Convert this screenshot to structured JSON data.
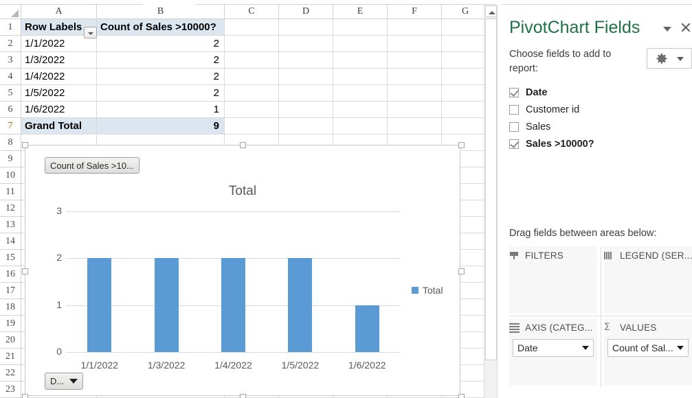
{
  "workbook": {
    "columns": [
      "A",
      "B",
      "C",
      "D",
      "E",
      "F",
      "G"
    ],
    "rows": [
      "1",
      "2",
      "3",
      "4",
      "5",
      "6",
      "7",
      "8",
      "9",
      "10",
      "11",
      "12",
      "13",
      "14",
      "15",
      "16",
      "17",
      "18",
      "19",
      "20",
      "21",
      "22",
      "23"
    ],
    "pivot_table": {
      "headers": [
        "Row Labels",
        "Count of Sales >10000?"
      ],
      "rows": [
        {
          "label": "1/1/2022",
          "value": "2"
        },
        {
          "label": "1/3/2022",
          "value": "2"
        },
        {
          "label": "1/4/2022",
          "value": "2"
        },
        {
          "label": "1/5/2022",
          "value": "2"
        },
        {
          "label": "1/6/2022",
          "value": "1"
        }
      ],
      "total": {
        "label": "Grand Total",
        "value": "9"
      }
    }
  },
  "chart": {
    "title": "Total",
    "series_field_button": "Count of Sales >10...",
    "axis_field_button": "D...",
    "legend": [
      {
        "label": "Total",
        "color": "#5b9bd5"
      }
    ]
  },
  "chart_data": {
    "type": "bar",
    "title": "Total",
    "categories": [
      "1/1/2022",
      "1/3/2022",
      "1/4/2022",
      "1/5/2022",
      "1/6/2022"
    ],
    "values": [
      2,
      2,
      2,
      2,
      1
    ],
    "series": [
      {
        "name": "Total",
        "values": [
          2,
          2,
          2,
          2,
          1
        ],
        "color": "#5b9bd5"
      }
    ],
    "xlabel": "",
    "ylabel": "",
    "ylim": [
      0,
      3
    ],
    "yticks": [
      "0",
      "1",
      "2",
      "3"
    ],
    "grid": true,
    "legend_position": "right"
  },
  "pane": {
    "title": "PivotChart Fields",
    "collapse_icon": "chevron-down-icon",
    "close_icon": "close-icon",
    "choose_label": "Choose fields to add to report:",
    "tools_icon": "gear-icon",
    "fields": [
      {
        "name": "Date",
        "checked": true,
        "bold": true
      },
      {
        "name": "Customer id",
        "checked": false,
        "bold": false
      },
      {
        "name": "Sales",
        "checked": false,
        "bold": false
      },
      {
        "name": "Sales >10000?",
        "checked": true,
        "bold": true
      }
    ],
    "drag_label": "Drag fields between areas below:",
    "areas": [
      {
        "key": "filters",
        "label": "FILTERS",
        "icon": "filter-icon",
        "items": []
      },
      {
        "key": "legend",
        "label": "LEGEND (SER...",
        "icon": "legend-icon",
        "items": []
      },
      {
        "key": "axis",
        "label": "AXIS (CATEG...",
        "icon": "axis-icon",
        "items": [
          "Date"
        ]
      },
      {
        "key": "values",
        "label": "VALUES",
        "icon": "sigma-icon",
        "items": [
          "Count of Sal..."
        ]
      }
    ]
  }
}
